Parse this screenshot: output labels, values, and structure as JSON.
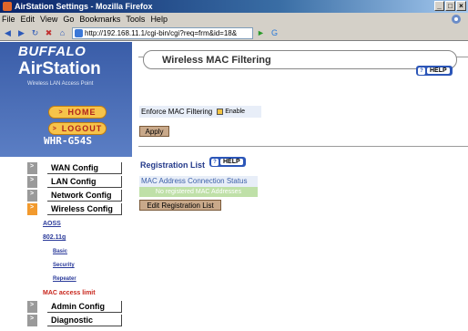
{
  "window": {
    "title": "AirStation Settings - Mozilla Firefox",
    "buttons": [
      "_",
      "□",
      "×"
    ]
  },
  "menubar": [
    "File",
    "Edit",
    "View",
    "Go",
    "Bookmarks",
    "Tools",
    "Help"
  ],
  "address": {
    "url": "http://192.168.11.1/cgi-bin/cgi?req=frm&id=18&"
  },
  "brand": {
    "buffalo": "BUFFALO",
    "airstation": "AirStation",
    "tagline": "Wireless LAN Access Point",
    "model": "WHR-G54S"
  },
  "nav_pills": {
    "home": "HOME",
    "logout": "LOGOUT"
  },
  "sidebar": {
    "items": [
      {
        "label": "WAN Config"
      },
      {
        "label": "LAN Config"
      },
      {
        "label": "Network Config"
      },
      {
        "label": "Wireless Config"
      }
    ],
    "sub": {
      "aoss": "AOSS",
      "b80211g": "802.11g",
      "basic": "Basic",
      "security": "Security",
      "repeater": "Repeater",
      "mac": "MAC access limit"
    },
    "items2": [
      {
        "label": "Admin Config"
      },
      {
        "label": "Diagnostic"
      }
    ]
  },
  "main": {
    "title": "Wireless MAC Filtering",
    "help": "HELP",
    "enforce_label": "Enforce MAC Filtering",
    "enable_label": "Enable",
    "enforce_checked": false,
    "apply": "Apply",
    "reg_title": "Registration List",
    "mac_status": "MAC Address Connection Status",
    "no_reg": "No registered MAC Addresses",
    "edit_btn": "Edit Registration List"
  }
}
